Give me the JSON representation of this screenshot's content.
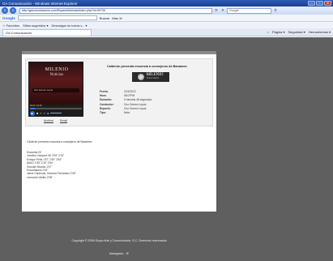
{
  "window": {
    "title": "GA Comunicación - Windows Internet Explorer",
    "controls": [
      "–",
      "▫",
      "✕"
    ]
  },
  "address": {
    "url": "http://gacomunicacion.com/EspacioNoticias/index.php?id=00735",
    "search_placeholder": "Google"
  },
  "toolbar": {
    "google_label": "Google",
    "buscar_label": "Buscar",
    "more_label": "Más ≫"
  },
  "favorites": {
    "favorites_label": "Favoritos",
    "sites_label": "Sitios sugeridos ▾",
    "slice_label": "Descargar la nueva v... ▾"
  },
  "tab": {
    "title": "GA Comunicación",
    "tools": [
      "Página ▾",
      "Seguridad ▾",
      "Herramientas ▾"
    ]
  },
  "page": {
    "player": {
      "logo_line1": "MILENIO",
      "logo_line2": "Noticias",
      "caption": "Ciro Gómez Leyva",
      "time": "00:00 / 00:45",
      "progress": 0.1,
      "links": [
        "Archive",
        "Email"
      ]
    },
    "video_title": "Calderón presenta encuesta a consejeros de Banamex.",
    "brand": {
      "name": "MILENIO",
      "sub": "TELEVISIÓN"
    },
    "meta": [
      {
        "label": "Fecha:",
        "value": "22/2/2012"
      },
      {
        "label": "Hora:",
        "value": "08:07PM"
      },
      {
        "label": "Duración:",
        "value": "0 minutos 45 segundos"
      },
      {
        "label": "Conductor:",
        "value": "Ciro Gómez Leyva"
      },
      {
        "label": "Reportó:",
        "value": "Ciro Gómez Leyva"
      },
      {
        "label": "Tipo:",
        "value": "Nota"
      }
    ],
    "description": "Calderón presenta encuesta a consejeros de Banamex.",
    "credits": [
      "Encuesta 20'",
      "Josefina Vázquez 36' 2'09\" 2'15\"",
      "Enrique Peña 1'57\" 2'39\" 2'54\"",
      "AMLO 1'55\" 2'10\" 2'54\"",
      "Gonzalo Nicolau 1'47\"",
      "Encuestados 2'02\"",
      "Jaime Cárdenas, Gerardo Fernández 2'05\"",
      "Leonardo Valdés 2'08\""
    ],
    "footer_copy": "Copyright © 2006 Grupo Arte y Comunicación, S.C. Derechos reservados",
    "footer_nav": "Navegador - IE"
  }
}
